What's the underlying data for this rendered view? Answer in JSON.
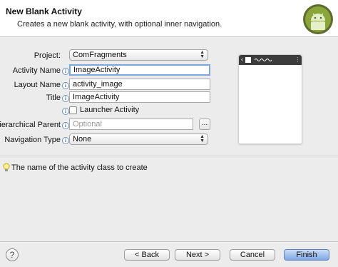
{
  "header": {
    "title": "New Blank Activity",
    "subtitle": "Creates a new blank activity, with optional inner navigation."
  },
  "form": {
    "project": {
      "label": "Project:",
      "value": "ComFragments"
    },
    "activity_name": {
      "label": "Activity Name",
      "value": "ImageActivity"
    },
    "layout_name": {
      "label": "Layout Name",
      "value": "activity_image"
    },
    "title": {
      "label": "Title",
      "value": "ImageActivity"
    },
    "launcher": {
      "label": "Launcher Activity",
      "checked": false
    },
    "hierarchical_parent": {
      "label": "Hierarchical Parent",
      "value": "",
      "placeholder": "Optional",
      "browse_label": "..."
    },
    "navigation_type": {
      "label": "Navigation Type",
      "value": "None"
    }
  },
  "status": {
    "message": "The name of the activity class to create"
  },
  "buttons": {
    "back": "< Back",
    "next": "Next >",
    "cancel": "Cancel",
    "finish": "Finish",
    "help": "?"
  },
  "icons": {
    "logo": "android-logo",
    "info": "info-icon",
    "status": "lightbulb-icon",
    "help": "help-icon"
  },
  "colors": {
    "focus_border": "#7aa7e0",
    "primary_button": "#7ea8e3",
    "android_green": "#9bc138"
  }
}
